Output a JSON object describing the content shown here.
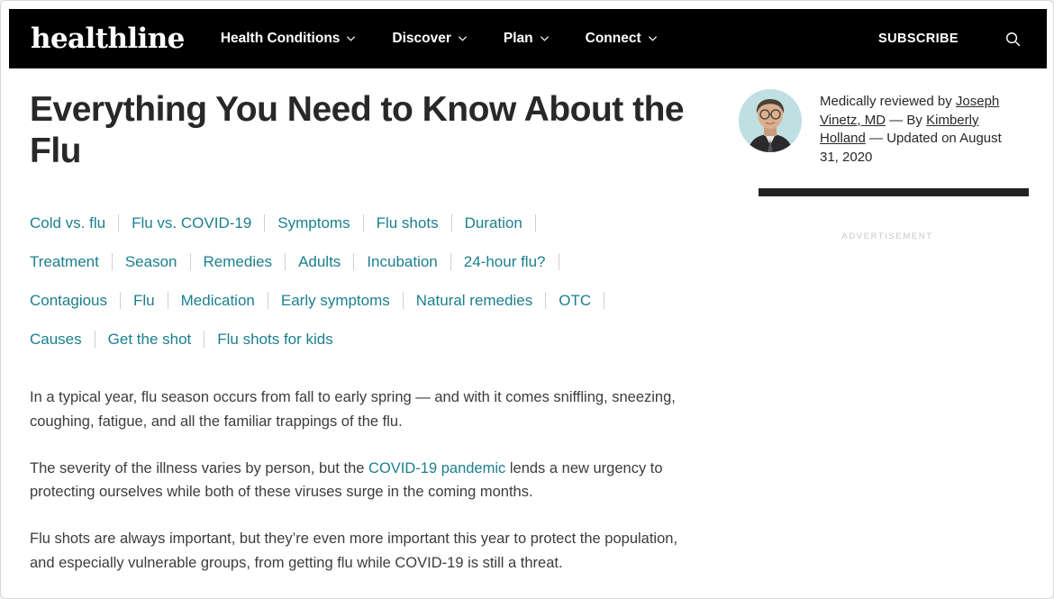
{
  "header": {
    "logo": "healthline",
    "nav_items": [
      {
        "label": "Health Conditions",
        "icon": "chevron-down-icon",
        "has_dropdown": true
      },
      {
        "label": "Discover",
        "icon": "chevron-down-icon",
        "has_dropdown": true
      },
      {
        "label": "Plan",
        "icon": "chevron-down-icon",
        "has_dropdown": true
      },
      {
        "label": "Connect",
        "icon": "chevron-down-icon",
        "has_dropdown": true
      }
    ],
    "subscribe_label": "SUBSCRIBE",
    "search_icon": "search-icon",
    "background_color": "#000000",
    "text_color": "#ffffff"
  },
  "article": {
    "title": "Everything You Need to Know About the Flu",
    "title_color": "#28282b"
  },
  "jump_links": {
    "link_color": "#1b7f8e",
    "rows": [
      [
        "Cold vs. flu",
        "Flu vs. COVID-19",
        "Symptoms",
        "Flu shots",
        "Duration"
      ],
      [
        "Treatment",
        "Season",
        "Remedies",
        "Adults",
        "Incubation",
        "24-hour flu?"
      ],
      [
        "Contagious",
        "Flu",
        "Medication",
        "Early symptoms",
        "Natural remedies",
        "OTC"
      ],
      [
        "Causes",
        "Get the shot",
        "Flu shots for kids"
      ]
    ]
  },
  "body": {
    "paragraph_1": "In a typical year, flu season occurs from fall to early spring — and with it comes sniffling, sneezing, coughing, fatigue, and all the familiar trappings of the flu.",
    "paragraph_2_before": "The severity of the illness varies by person, but the ",
    "paragraph_2_link": "COVID-19 pandemic",
    "paragraph_2_after": " lends a new urgency to protecting ourselves while both of these viruses surge in the coming months.",
    "paragraph_3": "Flu shots are always important, but they’re even more important this year to protect the population, and especially vulnerable groups, from getting flu while COVID-19 is still a threat.",
    "text_color": "#3c3c3c"
  },
  "sidebar": {
    "byline": {
      "reviewed_prefix": "Medically reviewed by ",
      "reviewer_name": "Joseph Vinetz, MD",
      "by_connector": " — By ",
      "author_name": "Kimberly Holland",
      "updated_text": " — Updated on August 31, 2020",
      "avatar_icon": "avatar",
      "avatar_background": "#bfdfe3"
    },
    "ad_label": "ADVERTISEMENT",
    "ad_rule_color": "#232326"
  }
}
